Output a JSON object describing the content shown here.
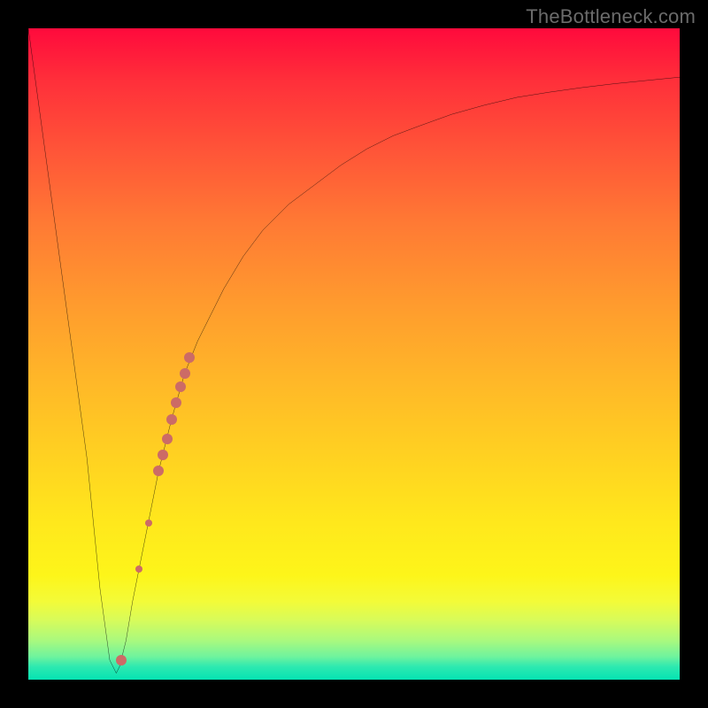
{
  "watermark": {
    "text": "TheBottleneck.com"
  },
  "colors": {
    "curve_stroke": "#000000",
    "dot_fill": "#cc6b66",
    "frame_bg": "#000000"
  },
  "chart_data": {
    "type": "line",
    "title": "",
    "xlabel": "",
    "ylabel": "",
    "xlim": [
      0,
      100
    ],
    "ylim": [
      0,
      100
    ],
    "grid": false,
    "legend": false,
    "series": [
      {
        "name": "bottleneck-curve",
        "x": [
          0,
          3,
          6,
          9,
          11,
          12.5,
          13.5,
          14,
          15,
          16,
          18,
          20,
          22,
          24,
          26,
          28,
          30,
          33,
          36,
          40,
          44,
          48,
          52,
          56,
          60,
          65,
          70,
          75,
          80,
          85,
          90,
          95,
          100
        ],
        "y": [
          100,
          78,
          56,
          34,
          14,
          3,
          1,
          2,
          6,
          12,
          22,
          32,
          40,
          47,
          52,
          56,
          60,
          65,
          69,
          73,
          76,
          79,
          81.5,
          83.5,
          85,
          86.8,
          88.2,
          89.4,
          90.2,
          90.9,
          91.5,
          92,
          92.5
        ]
      }
    ],
    "marker_series": {
      "name": "highlighted-points",
      "points": [
        {
          "x": 14.2,
          "y": 3,
          "r": 6
        },
        {
          "x": 17.0,
          "y": 17,
          "r": 4
        },
        {
          "x": 18.5,
          "y": 24,
          "r": 4
        },
        {
          "x": 20.0,
          "y": 32,
          "r": 6
        },
        {
          "x": 20.6,
          "y": 34.5,
          "r": 6
        },
        {
          "x": 21.3,
          "y": 37,
          "r": 6
        },
        {
          "x": 22.0,
          "y": 40,
          "r": 6
        },
        {
          "x": 22.7,
          "y": 42.5,
          "r": 6
        },
        {
          "x": 23.4,
          "y": 45,
          "r": 6
        },
        {
          "x": 24.0,
          "y": 47,
          "r": 6
        },
        {
          "x": 24.7,
          "y": 49.5,
          "r": 6
        }
      ]
    }
  }
}
